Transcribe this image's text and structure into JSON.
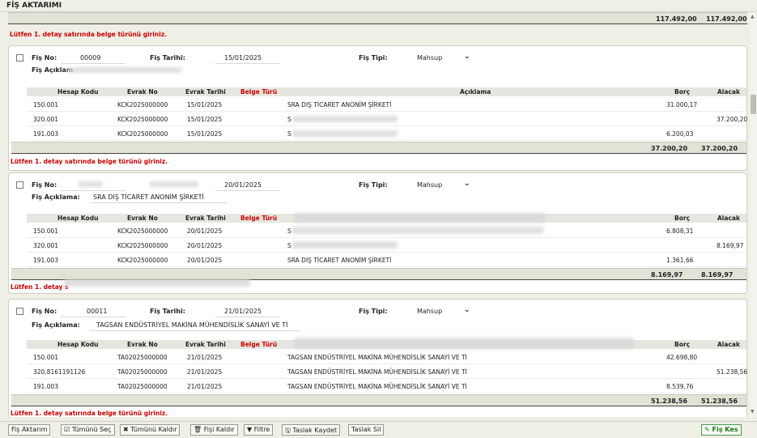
{
  "page": {
    "title": "FİŞ AKTARIMI"
  },
  "top_total": {
    "borc": "117.492,00",
    "alacak": "117.492,00"
  },
  "top_error": "Lütfen 1. detay satırında belge türünü giriniz.",
  "labels": {
    "fis_no": "Fiş No:",
    "fis_tarihi": "Fiş Tarihi:",
    "fis_tipi": "Fiş Tipi:",
    "fis_aciklama": "Fiş Açıklama:",
    "fis_aciklam_cut": "Fiş Açıklam",
    "col_hesap": "Hesap Kodu",
    "col_evrak_no": "Evrak No",
    "col_evrak_tarihi": "Evrak Tarihi",
    "col_belge": "Belge Türü",
    "col_aciklama": "Açıklama",
    "col_borc": "Borç",
    "col_alacak": "Alacak"
  },
  "vouchers": [
    {
      "fis_no": "00009",
      "fis_tarihi": "15/01/2025",
      "fis_tipi": "Mahsup",
      "fis_aciklama": "",
      "rows": [
        {
          "hesap": "150.001",
          "evrak_no": "KCK2025000000",
          "evrak_tarihi": "15/01/2025",
          "aciklama": "SRA DIŞ TİCARET ANONİM ŞİRKETİ",
          "borc": "31.000,17",
          "alacak": ""
        },
        {
          "hesap": "320.001",
          "evrak_no": "KCK2025000000",
          "evrak_tarihi": "15/01/2025",
          "aciklama": "S",
          "borc": "",
          "alacak": "37.200,20"
        },
        {
          "hesap": "191.003",
          "evrak_no": "KCK2025000000",
          "evrak_tarihi": "15/01/2025",
          "aciklama": "S",
          "borc": "6.200,03",
          "alacak": ""
        }
      ],
      "total_borc": "37.200,20",
      "total_alacak": "37.200,20",
      "error": "Lütfen 1. detay satırında belge türünü giriniz."
    },
    {
      "fis_no": "",
      "fis_tarihi": "20/01/2025",
      "fis_tipi": "Mahsup",
      "fis_aciklama": "SRA DIŞ TİCARET ANONİM ŞİRKETİ",
      "rows": [
        {
          "hesap": "150.001",
          "evrak_no": "KCK2025000000",
          "evrak_tarihi": "20/01/2025",
          "aciklama": "S",
          "borc": "6.808,31",
          "alacak": ""
        },
        {
          "hesap": "320.001",
          "evrak_no": "KCK2025000000",
          "evrak_tarihi": "20/01/2025",
          "aciklama": "S",
          "borc": "",
          "alacak": "8.169,97"
        },
        {
          "hesap": "191.003",
          "evrak_no": "KCK2025000000",
          "evrak_tarihi": "20/01/2025",
          "aciklama": "SRA DIŞ TİCARET ANONİM ŞİRKETİ",
          "borc": "1.361,66",
          "alacak": ""
        }
      ],
      "total_borc": "8.169,97",
      "total_alacak": "8.169,97",
      "error": "Lütfen 1. detay s"
    },
    {
      "fis_no": "00011",
      "fis_tarihi": "21/01/2025",
      "fis_tipi": "Mahsup",
      "fis_aciklama": "TAGSAN ENDÜSTRİYEL MAKİNA MÜHENDİSLİK SANAYİ VE Tİ",
      "rows": [
        {
          "hesap": "150.001",
          "evrak_no": "TA02025000000",
          "evrak_tarihi": "21/01/2025",
          "aciklama": "TAGSAN ENDÜSTRİYEL MAKİNA MÜHENDİSLİK SANAYİ VE Tİ",
          "borc": "42.698,80",
          "alacak": ""
        },
        {
          "hesap": "320.8161191126",
          "evrak_no": "TA02025000000",
          "evrak_tarihi": "21/01/2025",
          "aciklama": "TAGSAN ENDÜSTRİYEL MAKİNA MÜHENDİSLİK SANAYİ VE Tİ",
          "borc": "",
          "alacak": "51.238,56"
        },
        {
          "hesap": "191.003",
          "evrak_no": "TA02025000000",
          "evrak_tarihi": "21/01/2025",
          "aciklama": "TAGSAN ENDÜSTRİYEL MAKİNA MÜHENDİSLİK SANAYİ VE Tİ",
          "borc": "8.539,76",
          "alacak": ""
        }
      ],
      "total_borc": "51.238,56",
      "total_alacak": "51.238,56",
      "error": "Lütfen 1. detay satırında belge türünü giriniz."
    }
  ],
  "footer": {
    "fis_aktarim": "Fiş Aktarım",
    "tumunu_sec": "Tümünü Seç",
    "tumunu_kaldir": "Tümünü Kaldır",
    "fisi_kaldir": "Fişi Kaldır",
    "filtre": "Filtre",
    "taslak_kaydet": "Taslak Kaydet",
    "taslak_sil": "Taslak Sil",
    "fis_kes": "Fiş Kes"
  },
  "icons": {
    "dropdown": "chevron-down-icon",
    "checkbox": "checkbox-icon"
  },
  "colors": {
    "error": "#cc0000",
    "background": "#efefe6",
    "accent_green": "#1a7a1a"
  }
}
